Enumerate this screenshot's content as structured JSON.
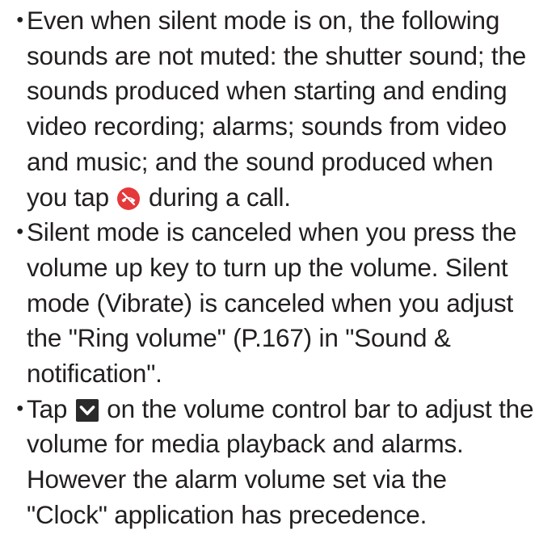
{
  "bullet_char": "・",
  "notes": [
    {
      "before": "Even when silent mode is on, the following sounds are not muted: the shutter sound; the sounds produced when starting and ending video recording; alarms; sounds from video and music; and the sound produced when you tap ",
      "icon": "end-call-icon",
      "after": " during a call."
    },
    {
      "text": "Silent mode is canceled when you press the volume up key to turn up the volume. Silent mode (Vibrate) is canceled when you adjust the \"Ring volume\" (P.167) in \"Sound & notification\"."
    },
    {
      "before": "Tap ",
      "icon": "chevron-down-icon",
      "after": " on the volume control bar to adjust the volume for media playback and alarms. However the alarm volume set via the \"Clock\" application has precedence."
    }
  ],
  "colors": {
    "text": "#231f20",
    "end_call_icon": "#e5383b",
    "chevron_icon_bg": "#2a2a2a"
  }
}
